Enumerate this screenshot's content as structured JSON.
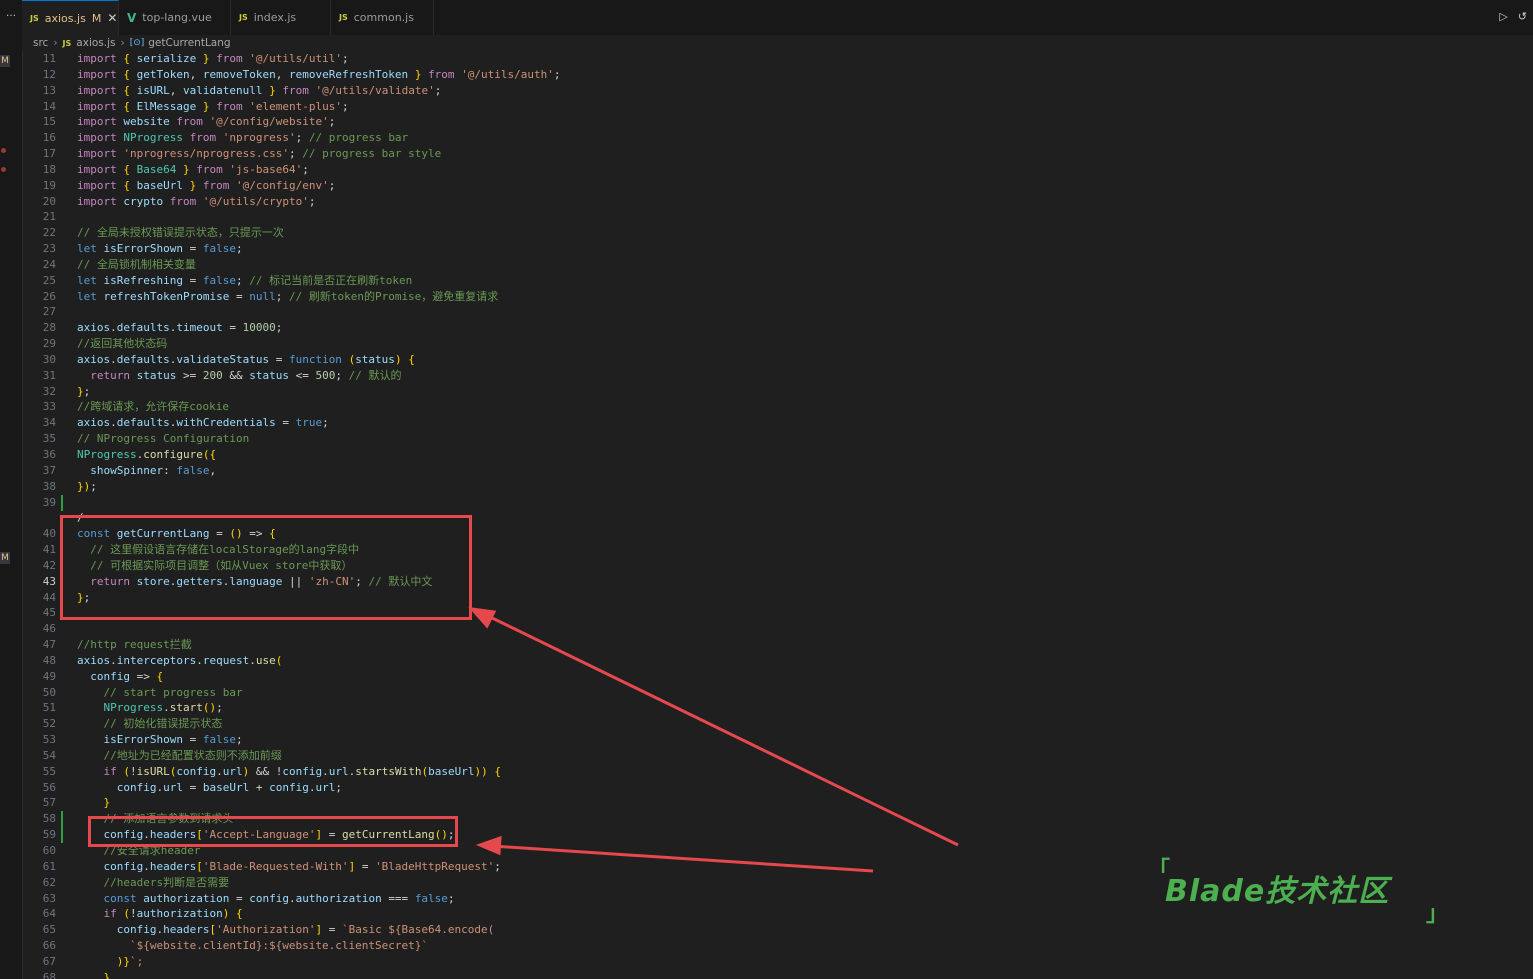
{
  "activity": {
    "dots": "…",
    "badges": [
      "M",
      "M"
    ]
  },
  "tabs": [
    {
      "label": "axios.js",
      "lang": "JS",
      "modified": "M",
      "active": true
    },
    {
      "label": "top-lang.vue",
      "lang": "V",
      "active": false
    },
    {
      "label": "index.js",
      "lang": "JS",
      "active": false
    },
    {
      "label": "common.js",
      "lang": "JS",
      "active": false
    }
  ],
  "tab_actions": {
    "run": "▷",
    "history": "↺"
  },
  "breadcrumb": {
    "folder": "src",
    "file_lang": "JS",
    "file": "axios.js",
    "symbol_icon": "[⊙]",
    "symbol": "getCurrentLang"
  },
  "code_lines": [
    {
      "n": "11",
      "t": "import { serialize } from '@/utils/util';"
    },
    {
      "n": "12",
      "t": "import { getToken, removeToken, removeRefreshToken } from '@/utils/auth';"
    },
    {
      "n": "13",
      "t": "import { isURL, validatenull } from '@/utils/validate';"
    },
    {
      "n": "14",
      "t": "import { ElMessage } from 'element-plus';"
    },
    {
      "n": "15",
      "t": "import website from '@/config/website';"
    },
    {
      "n": "16",
      "t": "import NProgress from 'nprogress'; // progress bar"
    },
    {
      "n": "17",
      "t": "import 'nprogress/nprogress.css'; // progress bar style"
    },
    {
      "n": "18",
      "t": "import { Base64 } from 'js-base64';"
    },
    {
      "n": "19",
      "t": "import { baseUrl } from '@/config/env';"
    },
    {
      "n": "20",
      "t": "import crypto from '@/utils/crypto';"
    },
    {
      "n": "21",
      "t": ""
    },
    {
      "n": "22",
      "t": "// 全局未授权错误提示状态，只提示一次"
    },
    {
      "n": "23",
      "t": "let isErrorShown = false;"
    },
    {
      "n": "24",
      "t": "// 全局锁机制相关变量"
    },
    {
      "n": "25",
      "t": "let isRefreshing = false; // 标记当前是否正在刷新token"
    },
    {
      "n": "26",
      "t": "let refreshTokenPromise = null; // 刷新token的Promise，避免重复请求"
    },
    {
      "n": "27",
      "t": ""
    },
    {
      "n": "28",
      "t": "axios.defaults.timeout = 10000;"
    },
    {
      "n": "29",
      "t": "//返回其他状态码"
    },
    {
      "n": "30",
      "t": "axios.defaults.validateStatus = function (status) {"
    },
    {
      "n": "31",
      "t": "  return status >= 200 && status <= 500; // 默认的"
    },
    {
      "n": "32",
      "t": "};"
    },
    {
      "n": "33",
      "t": "//跨域请求，允许保存cookie"
    },
    {
      "n": "34",
      "t": "axios.defaults.withCredentials = true;"
    },
    {
      "n": "35",
      "t": "// NProgress Configuration"
    },
    {
      "n": "36",
      "t": "NProgress.configure({"
    },
    {
      "n": "37",
      "t": "  showSpinner: false,"
    },
    {
      "n": "38",
      "t": "});"
    },
    {
      "n": "39",
      "t": ""
    },
    {
      "n": "",
      "t": "/"
    },
    {
      "n": "40",
      "t": "const getCurrentLang = () => {"
    },
    {
      "n": "41",
      "t": "  // 这里假设语言存储在localStorage的lang字段中"
    },
    {
      "n": "42",
      "t": "  // 可根据实际项目调整（如从Vuex store中获取）"
    },
    {
      "n": "43",
      "t": "  return store.getters.language || 'zh-CN'; // 默认中文"
    },
    {
      "n": "44",
      "t": "};"
    },
    {
      "n": "45",
      "t": ""
    },
    {
      "n": "46",
      "t": ""
    },
    {
      "n": "47",
      "t": "//http request拦截"
    },
    {
      "n": "48",
      "t": "axios.interceptors.request.use("
    },
    {
      "n": "49",
      "t": "  config => {"
    },
    {
      "n": "50",
      "t": "    // start progress bar"
    },
    {
      "n": "51",
      "t": "    NProgress.start();"
    },
    {
      "n": "52",
      "t": "    // 初始化错误提示状态"
    },
    {
      "n": "53",
      "t": "    isErrorShown = false;"
    },
    {
      "n": "54",
      "t": "    //地址为已经配置状态则不添加前缀"
    },
    {
      "n": "55",
      "t": "    if (!isURL(config.url) && !config.url.startsWith(baseUrl)) {"
    },
    {
      "n": "56",
      "t": "      config.url = baseUrl + config.url;"
    },
    {
      "n": "57",
      "t": "    }"
    },
    {
      "n": "58",
      "t": "    // 添加语言参数到请求头"
    },
    {
      "n": "59",
      "t": "    config.headers['Accept-Language'] = getCurrentLang();"
    },
    {
      "n": "60",
      "t": "    //安全请求header"
    },
    {
      "n": "61",
      "t": "    config.headers['Blade-Requested-With'] = 'BladeHttpRequest';"
    },
    {
      "n": "62",
      "t": "    //headers判断是否需要"
    },
    {
      "n": "63",
      "t": "    const authorization = config.authorization === false;"
    },
    {
      "n": "64",
      "t": "    if (!authorization) {"
    },
    {
      "n": "65",
      "t": "      config.headers['Authorization'] = `Basic ${Base64.encode("
    },
    {
      "n": "66",
      "t": "        `${website.clientId}:${website.clientSecret}`"
    },
    {
      "n": "67",
      "t": "      )}`;"
    },
    {
      "n": "68",
      "t": "    }"
    }
  ],
  "current_line": "43",
  "watermark": {
    "open": "「",
    "text": "Blade技术社区",
    "close": "」"
  },
  "annotation_color": "#e5484d",
  "accent": "#0078d4"
}
